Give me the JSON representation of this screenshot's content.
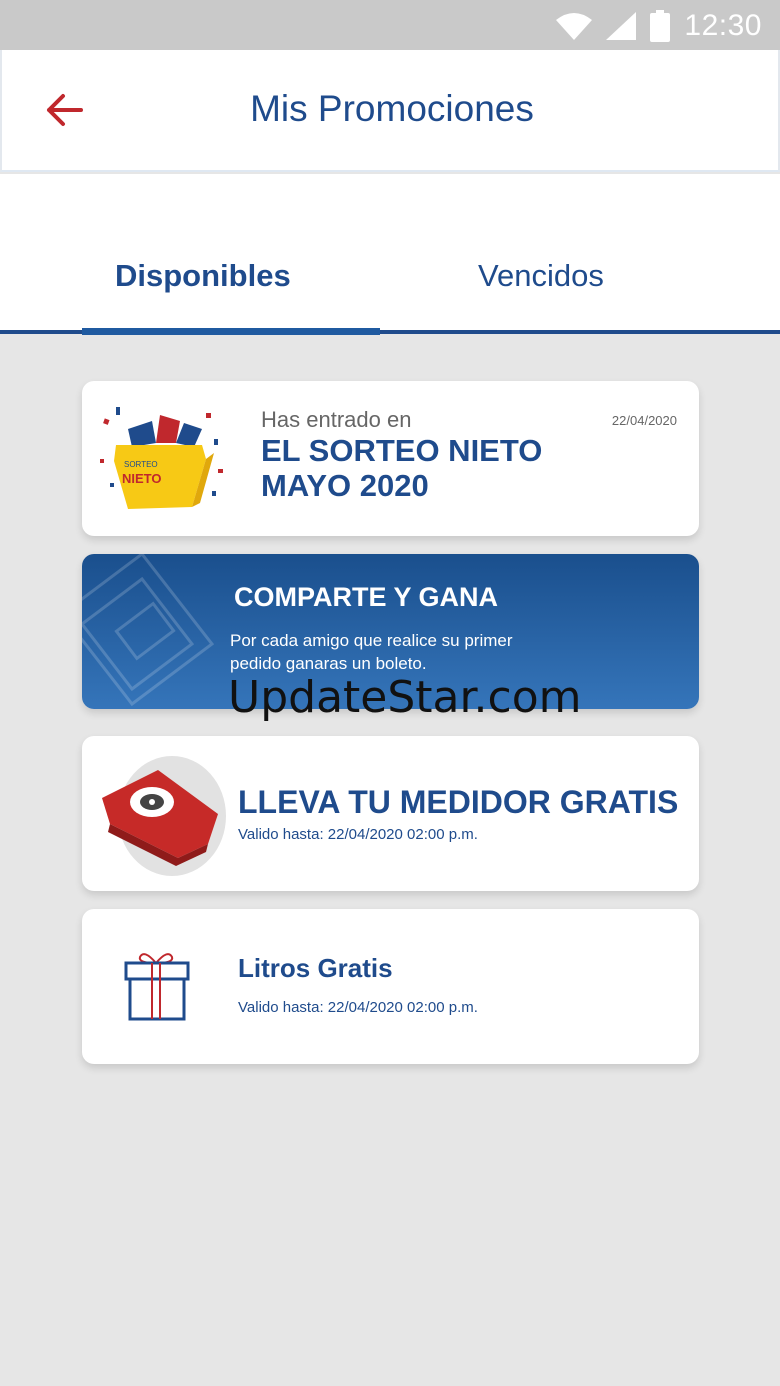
{
  "status_bar": {
    "time": "12:30",
    "icons": [
      "wifi-icon",
      "signal-icon",
      "battery-icon"
    ]
  },
  "app_bar": {
    "title": "Mis Promociones",
    "back_icon": "arrow-left-icon"
  },
  "tabs": [
    {
      "label": "Disponibles",
      "active": true
    },
    {
      "label": "Vencidos",
      "active": false
    }
  ],
  "promotions": [
    {
      "subtitle": "Has entrado en",
      "title": "EL SORTEO NIETO MAYO 2020",
      "date": "22/04/2020",
      "image_text": [
        "SORTEO",
        "NIETO"
      ],
      "icon": "gift-box-icon"
    },
    {
      "title": "COMPARTE Y GANA",
      "description": "Por cada amigo que realice su primer pedido ganaras un boleto.",
      "icon": "ticket-icon"
    },
    {
      "title": "LLEVA TU MEDIDOR GRATIS",
      "valid": "Valido hasta: 22/04/2020 02:00 p.m.",
      "icon": "gas-meter-icon"
    },
    {
      "title": "Litros Gratis",
      "valid": "Valido hasta: 22/04/2020 02:00 p.m.",
      "icon": "gift-icon"
    }
  ],
  "watermark": "UpdateStar.com",
  "colors": {
    "primary": "#1f4b8c",
    "accent_red": "#c0282d",
    "background": "#e6e6e6"
  }
}
